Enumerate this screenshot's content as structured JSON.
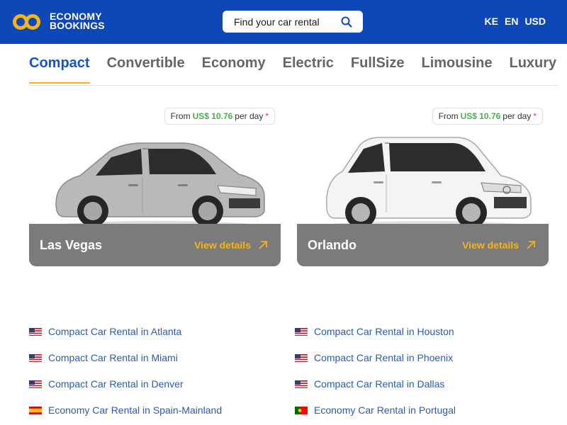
{
  "header": {
    "logo_line1": "ECONOMY",
    "logo_line2": "BOOKINGS",
    "search_placeholder": "Find your car rental",
    "country": "KE",
    "language": "EN",
    "currency": "USD"
  },
  "tabs": [
    {
      "label": "Compact",
      "active": true
    },
    {
      "label": "Convertible"
    },
    {
      "label": "Economy"
    },
    {
      "label": "Electric"
    },
    {
      "label": "FullSize"
    },
    {
      "label": "Limousine"
    },
    {
      "label": "Luxury"
    }
  ],
  "cards": [
    {
      "city": "Las Vegas",
      "price_prefix": "From",
      "price": "US$ 10.76",
      "price_suffix": "per day",
      "asterisk": "*",
      "details": "View details",
      "car_color": "silver"
    },
    {
      "city": "Orlando",
      "price_prefix": "From",
      "price": "US$ 10.76",
      "price_suffix": "per day",
      "asterisk": "*",
      "details": "View details",
      "car_color": "white"
    }
  ],
  "links": [
    {
      "text": "Compact Car Rental in Atlanta",
      "flag": "us-flag"
    },
    {
      "text": "Compact Car Rental in Houston",
      "flag": "us-flag"
    },
    {
      "text": "Compact Car Rental in Miami",
      "flag": "us-flag"
    },
    {
      "text": "Compact Car Rental in Phoenix",
      "flag": "us-flag"
    },
    {
      "text": "Compact Car Rental in Denver",
      "flag": "us-flag"
    },
    {
      "text": "Compact Car Rental in Dallas",
      "flag": "us-flag"
    },
    {
      "text": "Economy Car Rental in Spain-Mainland",
      "flag": "spain-flag"
    },
    {
      "text": "Economy Car Rental in Portugal",
      "flag": "portugal-flag"
    }
  ],
  "colors": {
    "header_bg": "#0d47b8",
    "accent_yellow": "#f4b41a",
    "active_tab": "#1557c0",
    "price_green": "#4caf50",
    "link_blue": "#2b5bb3",
    "card_bar": "#7b7b7b"
  }
}
